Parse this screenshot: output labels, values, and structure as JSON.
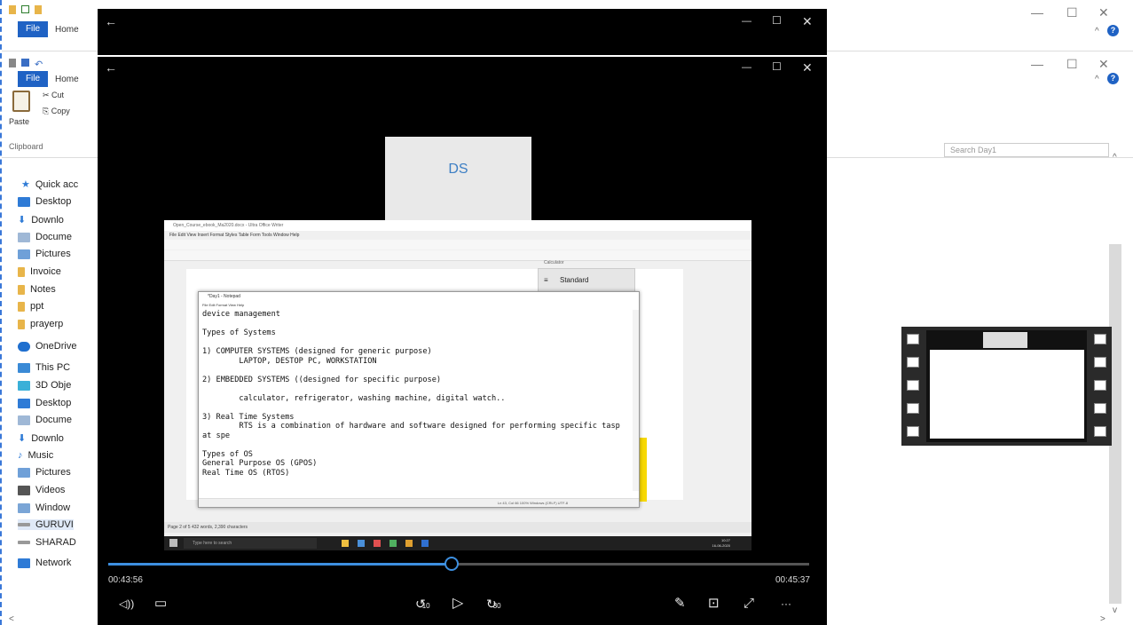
{
  "explorer": {
    "file_tab": "File",
    "home_tab": "Home",
    "ribbon": {
      "paste": "Paste",
      "cut": "Cut",
      "copy": "Copy",
      "group": "Clipboard"
    },
    "search_placeholder": "Search Day1",
    "nav": [
      "Quick acc",
      "Desktop",
      "Downlo",
      "Docume",
      "Pictures",
      "Invoice",
      "Notes",
      "ppt",
      "prayerp",
      "OneDrive",
      "This PC",
      "3D Obje",
      "Desktop",
      "Docume",
      "Downlo",
      "Music",
      "Pictures",
      "Videos",
      "Window",
      "GURUVI",
      "SHARAD",
      "Network"
    ],
    "help_glyph": "?"
  },
  "player": {
    "back_glyph": "←",
    "min_glyph": "—",
    "max_glyph": "☐",
    "close_glyph": "✕",
    "avatar_initials": "DS",
    "elapsed": "00:43:56",
    "remaining": "00:45:37",
    "progress": 0.49,
    "volume_glyph": "◁))",
    "captions_glyph": "▭",
    "skip_back_label": "10",
    "play_glyph": "▷",
    "skip_fwd_label": "30",
    "pen_glyph": "✎",
    "miniview_glyph": "⊡",
    "fullscreen_glyph": "⤢",
    "more_glyph": "···"
  },
  "share": {
    "writer_title": "Open_Course_ebook_Ma2020.docx - Ultra Office Writer",
    "writer_menu": "File  Edit  View  Insert  Format  Styles  Table  Form  Tools  Window  Help",
    "calc_title": "Calculator",
    "calc_mode": "Standard",
    "notepad_title": "*Day1 - Notepad",
    "notepad_menu": "File  Edit  Format  View  Help",
    "notepad_text": "device management\n\nTypes of Systems\n\n1) COMPUTER SYSTEMS (designed for generic purpose)\n        LAPTOP, DESTOP PC, WORKSTATION\n\n2) EMBEDDED SYSTEMS ((designed for specific purpose)\n\n        calculator, refrigerator, washing machine, digital watch..\n\n3) Real Time Systems\n        RTS is a combination of hardware and software designed for performing specific tasp\nat spe\n\nTypes of OS\nGeneral Purpose OS (GPOS)\nReal Time OS (RTOS)",
    "notepad_status": "Ln 43, Col 66      100%    Windows (CRLF)      UTF-8",
    "writer_status": "Page 2 of 5      432 words, 2,390 characters",
    "taskbar_search": "Type here to search",
    "clock": "10:27\n16-06-2020"
  },
  "colors": {
    "accent": "#3d8fe0",
    "file_tab": "#1f62c4",
    "highlight": "#f7d800"
  }
}
